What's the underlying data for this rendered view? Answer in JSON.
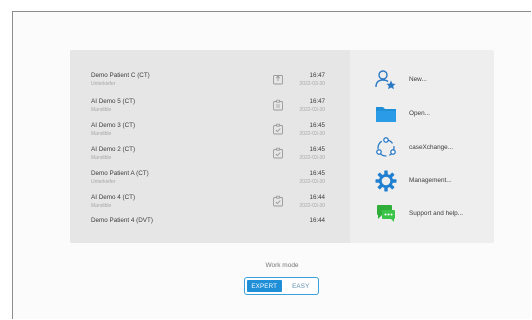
{
  "cases": [
    {
      "name": "Demo Patient C (CT)",
      "sub": "Unterkiefer",
      "time": "16:47",
      "date": "2022-03-30",
      "icon": "export-icon"
    },
    {
      "name": "AI Demo 5 (CT)",
      "sub": "Mandible",
      "time": "16:47",
      "date": "2022-03-30",
      "icon": "document-icon"
    },
    {
      "name": "AI Demo 3 (CT)",
      "sub": "Mandible",
      "time": "16:45",
      "date": "2022-03-30",
      "icon": "check-doc-icon"
    },
    {
      "name": "AI Demo 2 (CT)",
      "sub": "Mandible",
      "time": "16:45",
      "date": "2022-03-30",
      "icon": "check-doc-icon"
    },
    {
      "name": "Demo Patient A (CT)",
      "sub": "Unterkiefer",
      "time": "16:45",
      "date": "2022-03-30",
      "icon": ""
    },
    {
      "name": "AI Demo 4 (CT)",
      "sub": "Mandible",
      "time": "16:44",
      "date": "2022-03-30",
      "icon": "check-doc-icon"
    },
    {
      "name": "Demo Patient 4 (DVT)",
      "sub": "",
      "time": "16:44",
      "date": "",
      "icon": ""
    }
  ],
  "actions": {
    "new": "New...",
    "open": "Open...",
    "casexchange": "caseXchange...",
    "management": "Management...",
    "support": "Support and help..."
  },
  "workmode": {
    "label": "Work mode",
    "expert": "EXPERT",
    "easy": "EASY",
    "selected": "EXPERT"
  },
  "colors": {
    "accent": "#1f8fd8",
    "support_green": "#2fae3a"
  }
}
